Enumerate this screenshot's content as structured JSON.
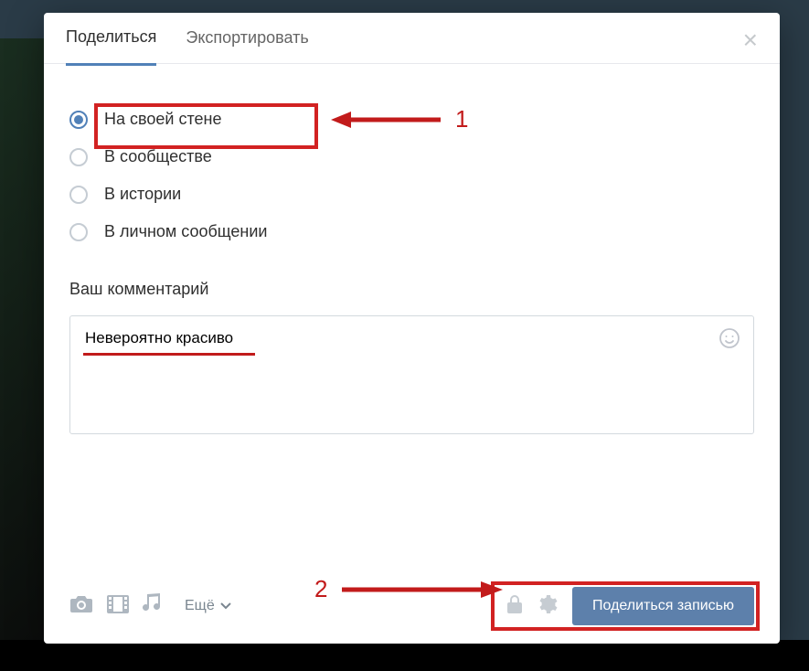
{
  "tabs": {
    "share": "Поделиться",
    "export": "Экспортировать"
  },
  "radios": {
    "own_wall": "На своей стене",
    "community": "В сообществе",
    "story": "В истории",
    "private_msg": "В личном сообщении"
  },
  "comment": {
    "label": "Ваш комментарий",
    "value": "Невероятно красиво"
  },
  "footer": {
    "more": "Ещё",
    "share_button": "Поделиться записью"
  },
  "annotations": {
    "n1": "1",
    "n2": "2"
  }
}
